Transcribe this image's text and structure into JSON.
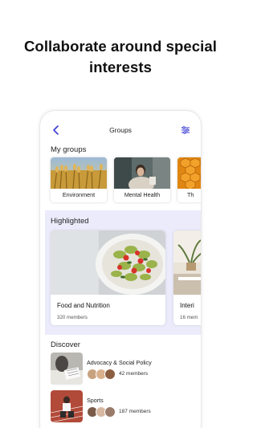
{
  "promo": {
    "line1": "Collaborate around special",
    "line2": "interests"
  },
  "header": {
    "title": "Groups"
  },
  "my_groups": {
    "title": "My groups",
    "items": [
      {
        "label": "Environment"
      },
      {
        "label": "Mental Health"
      },
      {
        "label": "Th"
      }
    ]
  },
  "highlighted": {
    "title": "Highlighted",
    "items": [
      {
        "name": "Food and Nutrition",
        "members": "320 members"
      },
      {
        "name": "Interi",
        "members": "16 mem"
      }
    ]
  },
  "discover": {
    "title": "Discover",
    "items": [
      {
        "name": "Advocacy & Social Policy",
        "count": "42 members"
      },
      {
        "name": "Sports",
        "count": "187 members"
      }
    ]
  },
  "colors": {
    "accent": "#3b3bd4",
    "highlight_bg": "#ebebfb"
  },
  "icons": [
    "back-icon",
    "filter-icon"
  ]
}
